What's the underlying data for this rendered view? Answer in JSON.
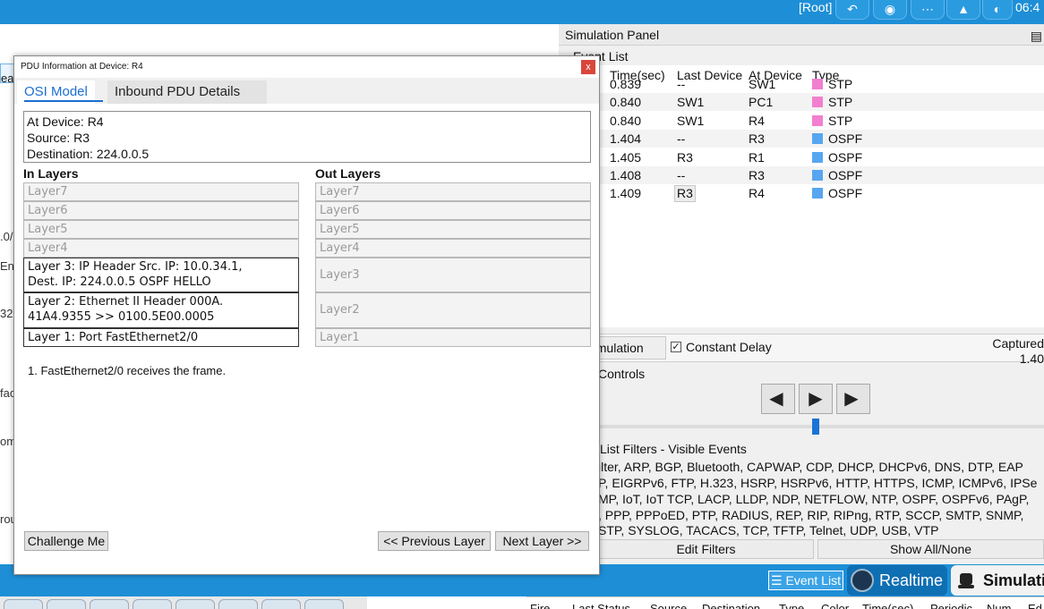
{
  "topbar": {
    "root_label": "[Root]",
    "clock": "06:4",
    "icons": [
      "undo-icon",
      "add-device-icon",
      "cluster-icon",
      "background-image-icon",
      "viewport-icon"
    ]
  },
  "workspace": {
    "area_label": "ea 0",
    "peek_texts": [
      ".0/",
      "Ena",
      "32",
      "fac",
      "om",
      "rou"
    ]
  },
  "simulation_panel": {
    "title": "Simulation Panel",
    "event_list_label": "Event List",
    "columns": [
      "Time(sec)",
      "Last Device",
      "At Device",
      "Type"
    ],
    "events": [
      {
        "time": "0.839",
        "last": "--",
        "at": "SW1",
        "type": "STP",
        "color": "#f27fcf"
      },
      {
        "time": "0.840",
        "last": "SW1",
        "at": "PC1",
        "type": "STP",
        "color": "#f27fcf"
      },
      {
        "time": "0.840",
        "last": "SW1",
        "at": "R4",
        "type": "STP",
        "color": "#f27fcf"
      },
      {
        "time": "1.404",
        "last": "--",
        "at": "R3",
        "type": "OSPF",
        "color": "#58a6f0"
      },
      {
        "time": "1.405",
        "last": "R3",
        "at": "R1",
        "type": "OSPF",
        "color": "#58a6f0"
      },
      {
        "time": "1.408",
        "last": "--",
        "at": "R3",
        "type": "OSPF",
        "color": "#58a6f0"
      },
      {
        "time": "1.409",
        "last": "R3",
        "at": "R4",
        "type": "OSPF",
        "color": "#58a6f0"
      }
    ],
    "reset_label": "Simulation",
    "constant_delay_label": "Constant Delay",
    "captured_label": "Captured",
    "captured_value": "1.40",
    "play_controls_label": "Controls",
    "filters_title": "List Filters - Visible Events",
    "filter_lines": [
      "ilter, ARP, BGP, Bluetooth, CAPWAP, CDP, DHCP, DHCPv6, DNS, DTP, EAP",
      "P, EIGRPv6, FTP, H.323, HSRP, HSRPv6, HTTP, HTTPS, ICMP, ICMPv6, IPSe",
      "MP, IoT, IoT TCP, LACP, LLDP, NDP, NETFLOW, NTP, OSPF, OSPFv6, PAgP,",
      ", PPP, PPPoED, PTP, RADIUS, REP, RIP, RIPng, RTP, SCCP, SMTP, SNMP,",
      "STP, SYSLOG, TACACS, TCP, TFTP, Telnet, UDP, USB, VTP"
    ],
    "edit_filters_label": "Edit Filters",
    "show_all_label": "Show All/None"
  },
  "bottombar": {
    "event_list_button": "Event List",
    "realtime_button": "Realtime",
    "simulation_button": "Simulati",
    "pdu_columns": [
      "Fire",
      "Last Status",
      "Source",
      "Destination",
      "Type",
      "Color",
      "Time(sec)",
      "Periodic",
      "Num",
      "Ed"
    ]
  },
  "dialog": {
    "title": "PDU Information at Device: R4",
    "close_glyph": "x",
    "tabs": [
      "OSI Model",
      "Inbound PDU Details"
    ],
    "info": {
      "at_device": "At Device: R4",
      "source": "Source: R3",
      "destination": "Destination: 224.0.0.5"
    },
    "in_layers_title": "In Layers",
    "out_layers_title": "Out Layers",
    "in_layers": [
      {
        "line1": "Layer7",
        "line2": ""
      },
      {
        "line1": "Layer6",
        "line2": ""
      },
      {
        "line1": "Layer5",
        "line2": ""
      },
      {
        "line1": "Layer4",
        "line2": ""
      },
      {
        "line1": "Layer 3: IP Header Src. IP: 10.0.34.1,",
        "line2": "Dest. IP: 224.0.0.5 OSPF HELLO"
      },
      {
        "line1": "Layer 2: Ethernet II Header 000A.",
        "line2": "41A4.9355 >> 0100.5E00.0005"
      },
      {
        "line1": "Layer 1: Port FastEthernet2/0",
        "line2": ""
      }
    ],
    "out_layers": [
      "Layer7",
      "Layer6",
      "Layer5",
      "Layer4",
      "Layer3",
      "Layer2",
      "Layer1"
    ],
    "explanation": "1. FastEthernet2/0 receives the frame.",
    "challenge_button": "Challenge Me",
    "prev_button": "<< Previous Layer",
    "next_button": "Next Layer >>"
  }
}
